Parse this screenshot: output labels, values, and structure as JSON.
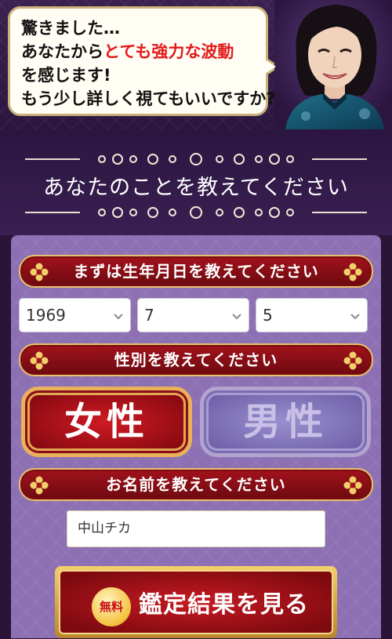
{
  "header": {
    "line1": "驚きました…",
    "line2_prefix": "あなたから",
    "line2_highlight": "とても強力な波動",
    "line3": "を感じます!",
    "line4": "もう少し詳しく視てもいいですか?"
  },
  "title": "あなたのことを教えてください",
  "birthday": {
    "heading": "まずは生年月日を教えてください",
    "year": "1969",
    "month": "7",
    "day": "5"
  },
  "gender": {
    "heading": "性別を教えてください",
    "female": "女性",
    "male": "男性",
    "selected": "female"
  },
  "name": {
    "heading": "お名前を教えてください",
    "value": "中山チカ"
  },
  "submit": {
    "badge": "無料",
    "label": "鑑定結果を見る"
  },
  "colors": {
    "accent_red": "#a2121c",
    "gold": "#e7c16b",
    "panel_purple": "#8d6fb3",
    "header_purple": "#2b1640"
  },
  "icons": [
    "fortune-teller-portrait",
    "ornament-knot-icon",
    "flower-icon",
    "chevron-down-icon"
  ]
}
